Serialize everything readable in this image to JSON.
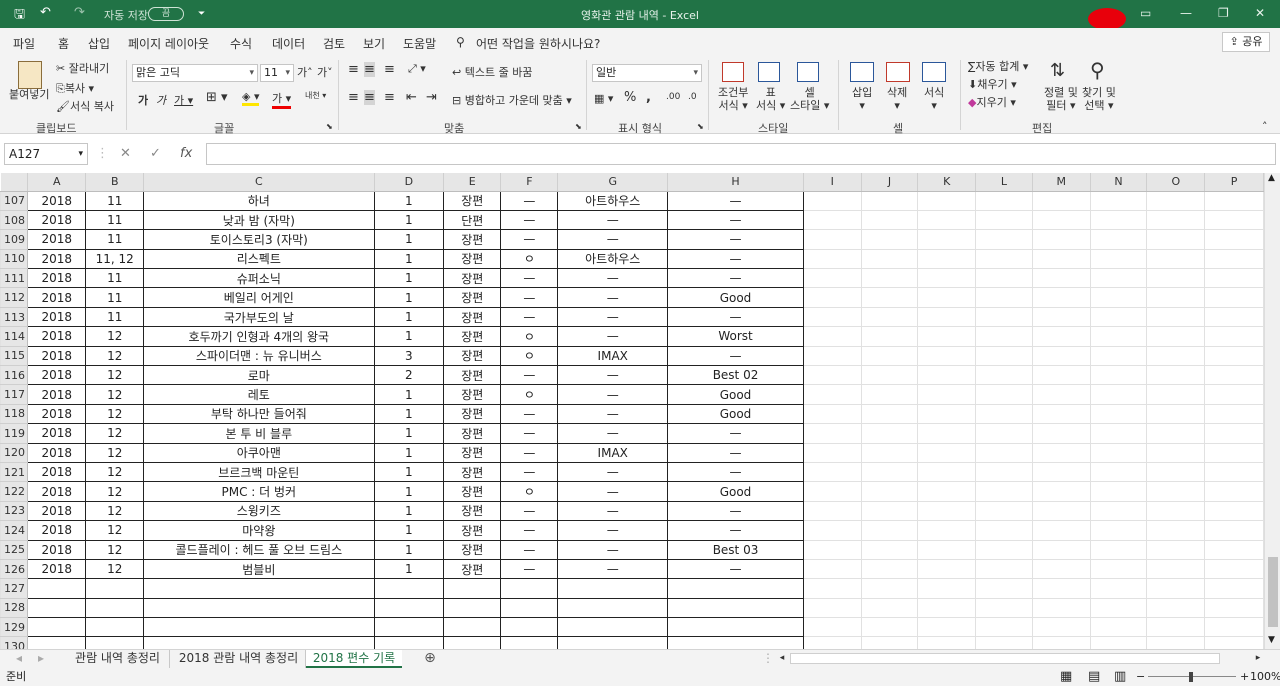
{
  "window": {
    "title": "영화관 관람 내역  -  Excel",
    "autosave_label": "자동 저장",
    "autosave_state": "끔"
  },
  "quick_access": {
    "save": "🖫",
    "undo": "↶",
    "redo": "↷",
    "customize": "⏷"
  },
  "tabs": [
    "파일",
    "홈",
    "삽입",
    "페이지 레이아웃",
    "수식",
    "데이터",
    "검토",
    "보기",
    "도움말"
  ],
  "active_tab": "홈",
  "tell_me": "어떤 작업을 원하시나요?",
  "share_label": "공유",
  "ribbon": {
    "paste": "붙여넣기",
    "cut": "잘라내기",
    "copy": "복사",
    "format_painter": "서식 복사",
    "font_name": "맑은 고딕",
    "font_size": "11",
    "wrap_text": "텍스트 줄 바꿈",
    "merge_center": "병합하고 가운데 맞춤",
    "number_format": "일반",
    "cond_format": [
      "조건부",
      "서식"
    ],
    "format_table": [
      "표",
      "서식"
    ],
    "cell_styles": [
      "셀",
      "스타일"
    ],
    "insert": "삽입",
    "delete": "삭제",
    "format": "서식",
    "autosum": "자동 합계",
    "fill": "채우기",
    "clear": "지우기",
    "sort_filter": [
      "정렬 및",
      "필터"
    ],
    "find_select": [
      "찾기 및",
      "선택"
    ],
    "groups": [
      "클립보드",
      "글꼴",
      "맞춤",
      "표시 형식",
      "스타일",
      "셀",
      "편집"
    ]
  },
  "name_box": "A127",
  "columns": [
    "A",
    "B",
    "C",
    "D",
    "E",
    "F",
    "G",
    "H",
    "I",
    "J",
    "K",
    "L",
    "M",
    "N",
    "O",
    "P"
  ],
  "rows": [
    {
      "n": "107",
      "a": "2018",
      "b": "11",
      "c": "하녀",
      "d": "1",
      "e": "장편",
      "f": "—",
      "g": "아트하우스",
      "h": "—"
    },
    {
      "n": "108",
      "a": "2018",
      "b": "11",
      "c": "낮과 밤 (자막)",
      "d": "1",
      "e": "단편",
      "f": "—",
      "g": "—",
      "h": "—"
    },
    {
      "n": "109",
      "a": "2018",
      "b": "11",
      "c": "토이스토리3 (자막)",
      "d": "1",
      "e": "장편",
      "f": "—",
      "g": "—",
      "h": "—"
    },
    {
      "n": "110",
      "a": "2018",
      "b": "11, 12",
      "c": "리스펙트",
      "d": "1",
      "e": "장편",
      "f": "ㅇ",
      "g": "아트하우스",
      "h": "—"
    },
    {
      "n": "111",
      "a": "2018",
      "b": "11",
      "c": "슈퍼소닉",
      "d": "1",
      "e": "장편",
      "f": "—",
      "g": "—",
      "h": "—"
    },
    {
      "n": "112",
      "a": "2018",
      "b": "11",
      "c": "베일리 어게인",
      "d": "1",
      "e": "장편",
      "f": "—",
      "g": "—",
      "h": "Good"
    },
    {
      "n": "113",
      "a": "2018",
      "b": "11",
      "c": "국가부도의 날",
      "d": "1",
      "e": "장편",
      "f": "—",
      "g": "—",
      "h": "—"
    },
    {
      "n": "114",
      "a": "2018",
      "b": "12",
      "c": "호두까기 인형과 4개의 왕국",
      "d": "1",
      "e": "장편",
      "f": "ㅇ",
      "g": "—",
      "h": "Worst"
    },
    {
      "n": "115",
      "a": "2018",
      "b": "12",
      "c": "스파이더맨 : 뉴 유니버스",
      "d": "3",
      "e": "장편",
      "f": "ㅇ",
      "g": "IMAX",
      "h": "—"
    },
    {
      "n": "116",
      "a": "2018",
      "b": "12",
      "c": "로마",
      "d": "2",
      "e": "장편",
      "f": "—",
      "g": "—",
      "h": "Best 02"
    },
    {
      "n": "117",
      "a": "2018",
      "b": "12",
      "c": "레토",
      "d": "1",
      "e": "장편",
      "f": "ㅇ",
      "g": "—",
      "h": "Good"
    },
    {
      "n": "118",
      "a": "2018",
      "b": "12",
      "c": "부탁 하나만 들어줘",
      "d": "1",
      "e": "장편",
      "f": "—",
      "g": "—",
      "h": "Good"
    },
    {
      "n": "119",
      "a": "2018",
      "b": "12",
      "c": "본 투 비 블루",
      "d": "1",
      "e": "장편",
      "f": "—",
      "g": "—",
      "h": "—"
    },
    {
      "n": "120",
      "a": "2018",
      "b": "12",
      "c": "아쿠아맨",
      "d": "1",
      "e": "장편",
      "f": "—",
      "g": "IMAX",
      "h": "—"
    },
    {
      "n": "121",
      "a": "2018",
      "b": "12",
      "c": "브르크백 마운틴",
      "d": "1",
      "e": "장편",
      "f": "—",
      "g": "—",
      "h": "—"
    },
    {
      "n": "122",
      "a": "2018",
      "b": "12",
      "c": "PMC : 더 벙커",
      "d": "1",
      "e": "장편",
      "f": "ㅇ",
      "g": "—",
      "h": "Good"
    },
    {
      "n": "123",
      "a": "2018",
      "b": "12",
      "c": "스윙키즈",
      "d": "1",
      "e": "장편",
      "f": "—",
      "g": "—",
      "h": "—"
    },
    {
      "n": "124",
      "a": "2018",
      "b": "12",
      "c": "마약왕",
      "d": "1",
      "e": "장편",
      "f": "—",
      "g": "—",
      "h": "—"
    },
    {
      "n": "125",
      "a": "2018",
      "b": "12",
      "c": "콜드플레이 : 헤드 풀 오브 드림스",
      "d": "1",
      "e": "장편",
      "f": "—",
      "g": "—",
      "h": "Best 03"
    },
    {
      "n": "126",
      "a": "2018",
      "b": "12",
      "c": "범블비",
      "d": "1",
      "e": "장편",
      "f": "—",
      "g": "—",
      "h": "—"
    },
    {
      "n": "127",
      "a": "",
      "b": "",
      "c": "",
      "d": "",
      "e": "",
      "f": "",
      "g": "",
      "h": ""
    },
    {
      "n": "128",
      "a": "",
      "b": "",
      "c": "",
      "d": "",
      "e": "",
      "f": "",
      "g": "",
      "h": ""
    },
    {
      "n": "129",
      "a": "",
      "b": "",
      "c": "",
      "d": "",
      "e": "",
      "f": "",
      "g": "",
      "h": ""
    },
    {
      "n": "130",
      "a": "",
      "b": "",
      "c": "",
      "d": "",
      "e": "",
      "f": "",
      "g": "",
      "h": ""
    }
  ],
  "sheet_tabs": [
    "관람 내역 총정리",
    "2018 관람 내역 총정리",
    "2018 편수 기록"
  ],
  "active_sheet": "2018 편수 기록",
  "status": {
    "mode": "준비",
    "zoom": "100%"
  }
}
